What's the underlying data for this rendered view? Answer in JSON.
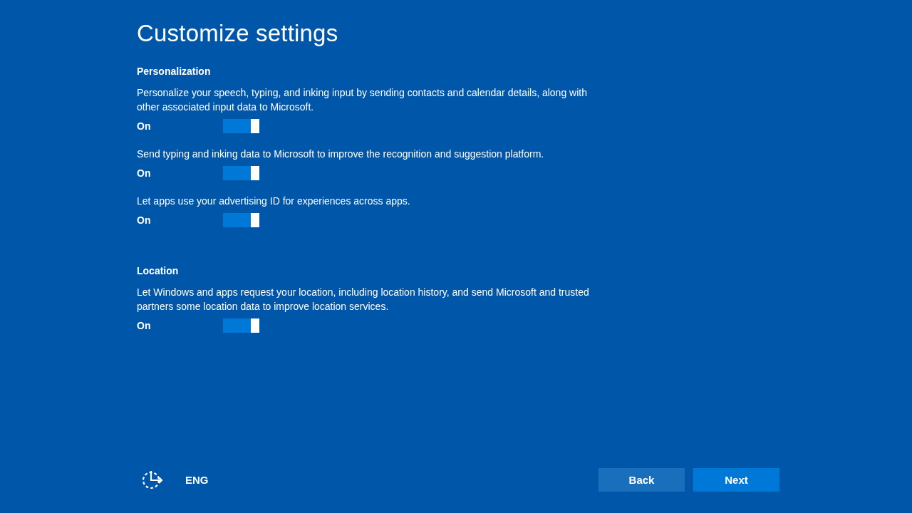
{
  "title": "Customize settings",
  "sections": [
    {
      "heading": "Personalization",
      "settings": [
        {
          "description": "Personalize your speech, typing, and inking input by sending contacts and calendar details, along with other associated input data to Microsoft.",
          "state_label": "On",
          "on": true
        },
        {
          "description": "Send typing and inking data to Microsoft to improve the recognition and suggestion platform.",
          "state_label": "On",
          "on": true
        },
        {
          "description": "Let apps use your advertising ID for experiences across apps.",
          "state_label": "On",
          "on": true
        }
      ]
    },
    {
      "heading": "Location",
      "settings": [
        {
          "description": "Let Windows and apps request your location, including location history, and send Microsoft and trusted partners some location data to improve location services.",
          "state_label": "On",
          "on": true
        }
      ]
    }
  ],
  "language": "ENG",
  "buttons": [
    {
      "label": "Back",
      "kind": "secondary"
    },
    {
      "label": "Next",
      "kind": "primary"
    }
  ]
}
